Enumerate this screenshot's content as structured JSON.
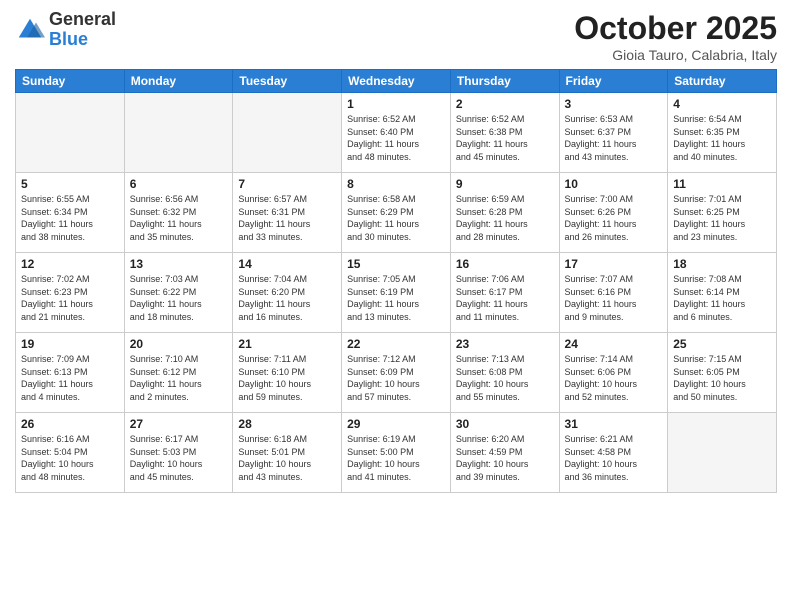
{
  "header": {
    "logo_line1": "General",
    "logo_line2": "Blue",
    "month": "October 2025",
    "location": "Gioia Tauro, Calabria, Italy"
  },
  "weekdays": [
    "Sunday",
    "Monday",
    "Tuesday",
    "Wednesday",
    "Thursday",
    "Friday",
    "Saturday"
  ],
  "weeks": [
    [
      {
        "day": "",
        "info": ""
      },
      {
        "day": "",
        "info": ""
      },
      {
        "day": "",
        "info": ""
      },
      {
        "day": "1",
        "info": "Sunrise: 6:52 AM\nSunset: 6:40 PM\nDaylight: 11 hours\nand 48 minutes."
      },
      {
        "day": "2",
        "info": "Sunrise: 6:52 AM\nSunset: 6:38 PM\nDaylight: 11 hours\nand 45 minutes."
      },
      {
        "day": "3",
        "info": "Sunrise: 6:53 AM\nSunset: 6:37 PM\nDaylight: 11 hours\nand 43 minutes."
      },
      {
        "day": "4",
        "info": "Sunrise: 6:54 AM\nSunset: 6:35 PM\nDaylight: 11 hours\nand 40 minutes."
      }
    ],
    [
      {
        "day": "5",
        "info": "Sunrise: 6:55 AM\nSunset: 6:34 PM\nDaylight: 11 hours\nand 38 minutes."
      },
      {
        "day": "6",
        "info": "Sunrise: 6:56 AM\nSunset: 6:32 PM\nDaylight: 11 hours\nand 35 minutes."
      },
      {
        "day": "7",
        "info": "Sunrise: 6:57 AM\nSunset: 6:31 PM\nDaylight: 11 hours\nand 33 minutes."
      },
      {
        "day": "8",
        "info": "Sunrise: 6:58 AM\nSunset: 6:29 PM\nDaylight: 11 hours\nand 30 minutes."
      },
      {
        "day": "9",
        "info": "Sunrise: 6:59 AM\nSunset: 6:28 PM\nDaylight: 11 hours\nand 28 minutes."
      },
      {
        "day": "10",
        "info": "Sunrise: 7:00 AM\nSunset: 6:26 PM\nDaylight: 11 hours\nand 26 minutes."
      },
      {
        "day": "11",
        "info": "Sunrise: 7:01 AM\nSunset: 6:25 PM\nDaylight: 11 hours\nand 23 minutes."
      }
    ],
    [
      {
        "day": "12",
        "info": "Sunrise: 7:02 AM\nSunset: 6:23 PM\nDaylight: 11 hours\nand 21 minutes."
      },
      {
        "day": "13",
        "info": "Sunrise: 7:03 AM\nSunset: 6:22 PM\nDaylight: 11 hours\nand 18 minutes."
      },
      {
        "day": "14",
        "info": "Sunrise: 7:04 AM\nSunset: 6:20 PM\nDaylight: 11 hours\nand 16 minutes."
      },
      {
        "day": "15",
        "info": "Sunrise: 7:05 AM\nSunset: 6:19 PM\nDaylight: 11 hours\nand 13 minutes."
      },
      {
        "day": "16",
        "info": "Sunrise: 7:06 AM\nSunset: 6:17 PM\nDaylight: 11 hours\nand 11 minutes."
      },
      {
        "day": "17",
        "info": "Sunrise: 7:07 AM\nSunset: 6:16 PM\nDaylight: 11 hours\nand 9 minutes."
      },
      {
        "day": "18",
        "info": "Sunrise: 7:08 AM\nSunset: 6:14 PM\nDaylight: 11 hours\nand 6 minutes."
      }
    ],
    [
      {
        "day": "19",
        "info": "Sunrise: 7:09 AM\nSunset: 6:13 PM\nDaylight: 11 hours\nand 4 minutes."
      },
      {
        "day": "20",
        "info": "Sunrise: 7:10 AM\nSunset: 6:12 PM\nDaylight: 11 hours\nand 2 minutes."
      },
      {
        "day": "21",
        "info": "Sunrise: 7:11 AM\nSunset: 6:10 PM\nDaylight: 10 hours\nand 59 minutes."
      },
      {
        "day": "22",
        "info": "Sunrise: 7:12 AM\nSunset: 6:09 PM\nDaylight: 10 hours\nand 57 minutes."
      },
      {
        "day": "23",
        "info": "Sunrise: 7:13 AM\nSunset: 6:08 PM\nDaylight: 10 hours\nand 55 minutes."
      },
      {
        "day": "24",
        "info": "Sunrise: 7:14 AM\nSunset: 6:06 PM\nDaylight: 10 hours\nand 52 minutes."
      },
      {
        "day": "25",
        "info": "Sunrise: 7:15 AM\nSunset: 6:05 PM\nDaylight: 10 hours\nand 50 minutes."
      }
    ],
    [
      {
        "day": "26",
        "info": "Sunrise: 6:16 AM\nSunset: 5:04 PM\nDaylight: 10 hours\nand 48 minutes."
      },
      {
        "day": "27",
        "info": "Sunrise: 6:17 AM\nSunset: 5:03 PM\nDaylight: 10 hours\nand 45 minutes."
      },
      {
        "day": "28",
        "info": "Sunrise: 6:18 AM\nSunset: 5:01 PM\nDaylight: 10 hours\nand 43 minutes."
      },
      {
        "day": "29",
        "info": "Sunrise: 6:19 AM\nSunset: 5:00 PM\nDaylight: 10 hours\nand 41 minutes."
      },
      {
        "day": "30",
        "info": "Sunrise: 6:20 AM\nSunset: 4:59 PM\nDaylight: 10 hours\nand 39 minutes."
      },
      {
        "day": "31",
        "info": "Sunrise: 6:21 AM\nSunset: 4:58 PM\nDaylight: 10 hours\nand 36 minutes."
      },
      {
        "day": "",
        "info": ""
      }
    ]
  ]
}
